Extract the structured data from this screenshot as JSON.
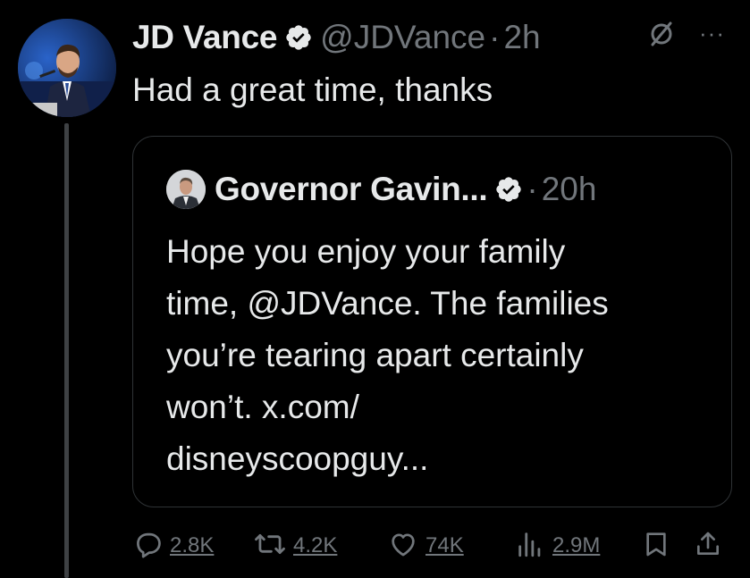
{
  "author": {
    "name": "JD Vance",
    "handle": "@JDVance",
    "separator": "·",
    "time": "2h",
    "more_label": "···"
  },
  "post": {
    "text": "Had a great time, thanks"
  },
  "quoted": {
    "name": "Governor Gavin...",
    "separator": "·",
    "time": "20h",
    "lines": [
      "Hope you enjoy your family",
      "time, @JDVance. The families",
      "you’re tearing apart certainly",
      "won’t. x.com/",
      "disneyscoopguy..."
    ]
  },
  "actions": {
    "replies": "2.8K",
    "reposts": "4.2K",
    "likes": "74K",
    "views": "2.9M"
  },
  "colors": {
    "background": "#000000",
    "text": "#e7e9ea",
    "muted": "#71767b",
    "verified": "#1d9bf0",
    "border": "#2f3336"
  },
  "icons": [
    "verified-badge-icon",
    "grok-icon",
    "more-icon",
    "reply-icon",
    "repost-icon",
    "like-icon",
    "views-icon",
    "bookmark-icon",
    "share-icon"
  ]
}
